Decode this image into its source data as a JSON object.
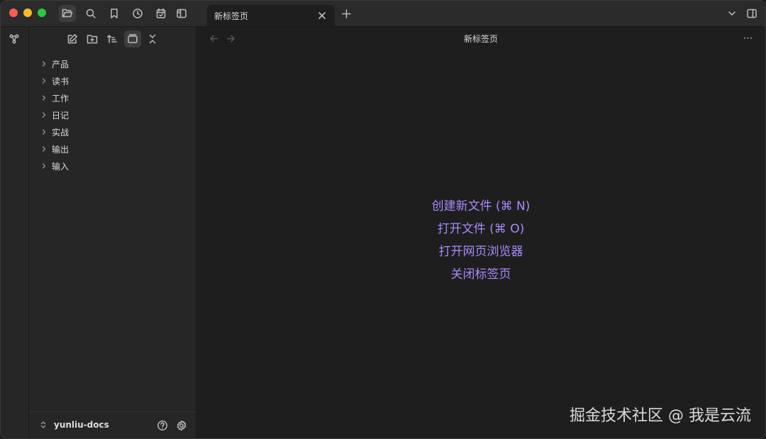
{
  "tab": {
    "title": "新标签页"
  },
  "view": {
    "title": "新标签页",
    "more_label": "⋯"
  },
  "tree": [
    {
      "label": "产品"
    },
    {
      "label": "读书"
    },
    {
      "label": "工作"
    },
    {
      "label": "日记"
    },
    {
      "label": "实战"
    },
    {
      "label": "输出"
    },
    {
      "label": "输入"
    }
  ],
  "vault": {
    "name": "yunliu-docs"
  },
  "actions": {
    "create": "创建新文件 (⌘ N)",
    "open": "打开文件 (⌘ O)",
    "browser": "打开网页浏览器",
    "close": "关闭标签页"
  },
  "watermark": "掘金技术社区 @ 我是云流",
  "colors": {
    "accent": "#a88bfa",
    "background": "#1e1e1e",
    "sidebar": "#262626"
  }
}
